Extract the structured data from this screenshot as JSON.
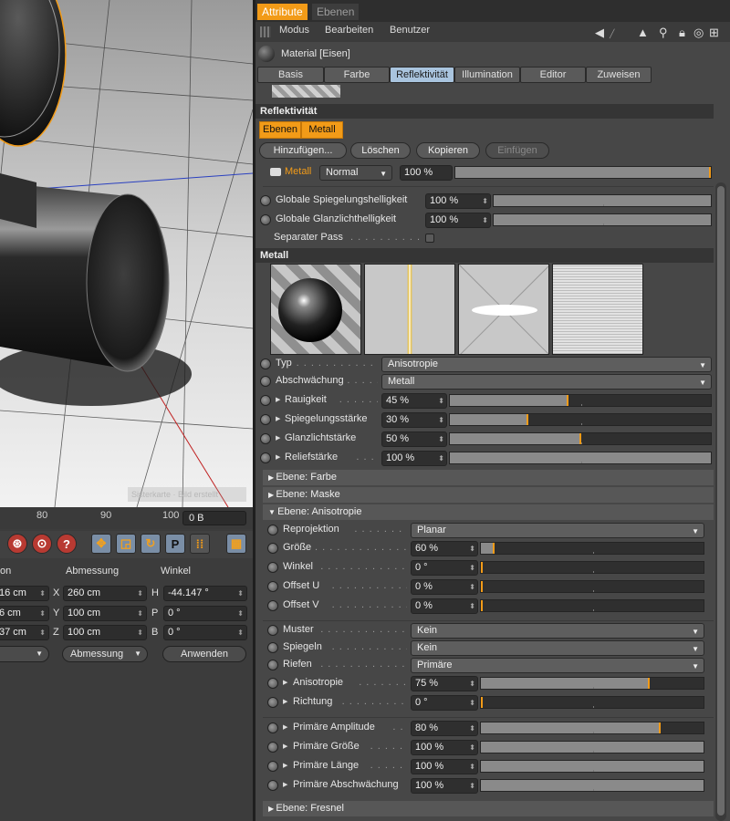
{
  "viewport": {
    "tag_text": "Sisterkarte · Bild erstellt"
  },
  "timeline": {
    "ticks": [
      "80",
      "90",
      "100"
    ],
    "frame_value": "0 B"
  },
  "coords": {
    "headers": [
      "on",
      "Abmessung",
      "Winkel"
    ],
    "rows": [
      {
        "pos": "16 cm",
        "axis": "X",
        "size": "260 cm",
        "rot_axis": "H",
        "rot": "-44.147 °"
      },
      {
        "pos": "6 cm",
        "axis": "Y",
        "size": "100 cm",
        "rot_axis": "P",
        "rot": "0 °"
      },
      {
        "pos": "37 cm",
        "axis": "Z",
        "size": "100 cm",
        "rot_axis": "B",
        "rot": "0 °"
      }
    ],
    "mode_label": "Abmessung",
    "apply_label": "Anwenden"
  },
  "panel": {
    "tabs": [
      "Attribute",
      "Ebenen"
    ],
    "menu": [
      "Modus",
      "Bearbeiten",
      "Benutzer"
    ],
    "material_name": "Material [Eisen]",
    "mat_tabs": [
      "Basis",
      "Farbe",
      "Reflektivität",
      "Illumination",
      "Editor",
      "Zuweisen"
    ],
    "section_reflect": "Reflektivität",
    "layer_tabs": [
      "Ebenen",
      "Metall"
    ],
    "layer_buttons": [
      "Hinzufügen...",
      "Löschen",
      "Kopieren",
      "Einfügen"
    ],
    "layer_row": {
      "name": "Metall",
      "mode": "Normal",
      "value": "100 %",
      "fill": 1.0
    },
    "global_rows": [
      {
        "label": "Globale Spiegelungshelligkeit",
        "value": "100 %",
        "fill": 1.0
      },
      {
        "label": "Globale Glanzlichthelligkeit",
        "value": "100 %",
        "fill": 1.0
      }
    ],
    "separate_pass": "Separater Pass",
    "section_metal": "Metall",
    "metal_dropdowns": [
      {
        "label": "Typ",
        "value": "Anisotropie"
      },
      {
        "label": "Abschwächung",
        "value": "Metall"
      }
    ],
    "metal_sliders": [
      {
        "label": "Rauigkeit",
        "value": "45 %",
        "fill": 0.45
      },
      {
        "label": "Spiegelungsstärke",
        "value": "30 %",
        "fill": 0.3
      },
      {
        "label": "Glanzlichtstärke",
        "value": "50 %",
        "fill": 0.5
      },
      {
        "label": "Reliefstärke",
        "value": "100 %",
        "fill": 1.0
      }
    ],
    "folds": [
      "Ebene: Farbe",
      "Ebene: Maske",
      "Ebene: Anisotropie",
      "Ebene: Fresnel"
    ],
    "aniso_dropdown": {
      "label": "Reprojektion",
      "value": "Planar"
    },
    "aniso_sliders": [
      {
        "label": "Größe",
        "value": "60 %",
        "fill": 0.06
      },
      {
        "label": "Winkel",
        "value": "0 °",
        "fill": 0.0
      },
      {
        "label": "Offset U",
        "value": "0 %",
        "fill": 0.0
      },
      {
        "label": "Offset V",
        "value": "0 %",
        "fill": 0.0
      }
    ],
    "pattern_dropdowns": [
      {
        "label": "Muster",
        "value": "Kein"
      },
      {
        "label": "Spiegeln",
        "value": "Kein"
      },
      {
        "label": "Riefen",
        "value": "Primäre"
      }
    ],
    "pattern_sliders": [
      {
        "label": "Anisotropie",
        "value": "75 %",
        "fill": 0.75
      },
      {
        "label": "Richtung",
        "value": "0 °",
        "fill": 0.0
      }
    ],
    "primary_sliders": [
      {
        "label": "Primäre Amplitude",
        "value": "80 %",
        "fill": 0.8
      },
      {
        "label": "Primäre Größe",
        "value": "100 %",
        "fill": 1.0
      },
      {
        "label": "Primäre Länge",
        "value": "100 %",
        "fill": 1.0
      },
      {
        "label": "Primäre Abschwächung",
        "value": "100 %",
        "fill": 1.0
      }
    ]
  }
}
